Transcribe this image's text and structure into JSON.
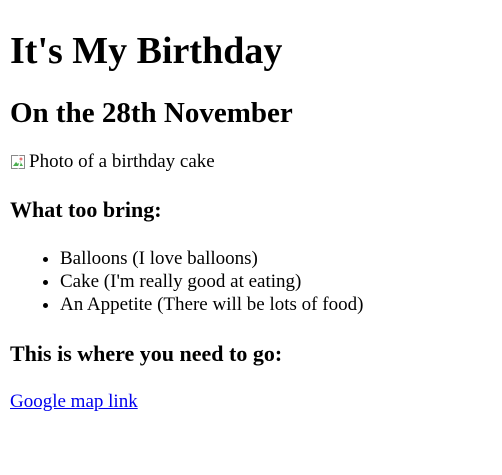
{
  "page": {
    "title": "It's My Birthday",
    "subtitle": "On the 28th November",
    "image_alt": "Photo of a birthday cake",
    "bring_heading": "What too bring:",
    "bring_items": [
      "Balloons (I love balloons)",
      "Cake (I'm really good at eating)",
      "An Appetite (There will be lots of food)"
    ],
    "where_heading": "This is where you need to go:",
    "map_link_text": "Google map link"
  },
  "colors": {
    "link": "#0000ee",
    "text": "#000000",
    "background": "#ffffff"
  },
  "icons": {
    "broken_image": "broken-image-icon"
  }
}
